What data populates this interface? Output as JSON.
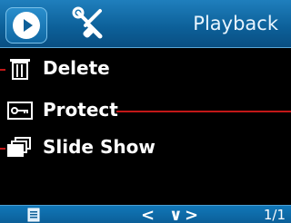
{
  "header": {
    "title": "Playback",
    "tabs": [
      {
        "name": "playback",
        "icon": "play-icon",
        "active": true
      },
      {
        "name": "tools",
        "icon": "tools-icon",
        "active": false
      }
    ]
  },
  "menu": {
    "items": [
      {
        "label": "Delete",
        "icon": "trash-icon"
      },
      {
        "label": "Protect",
        "icon": "key-icon"
      },
      {
        "label": "Slide Show",
        "icon": "slideshow-icon"
      }
    ]
  },
  "footer": {
    "page": "1/1",
    "nav_prev": "<",
    "nav_down": "∨",
    "nav_next": ">"
  },
  "colors": {
    "header": "#0c5f98",
    "accent_line": "#c21818",
    "background": "#000000"
  }
}
